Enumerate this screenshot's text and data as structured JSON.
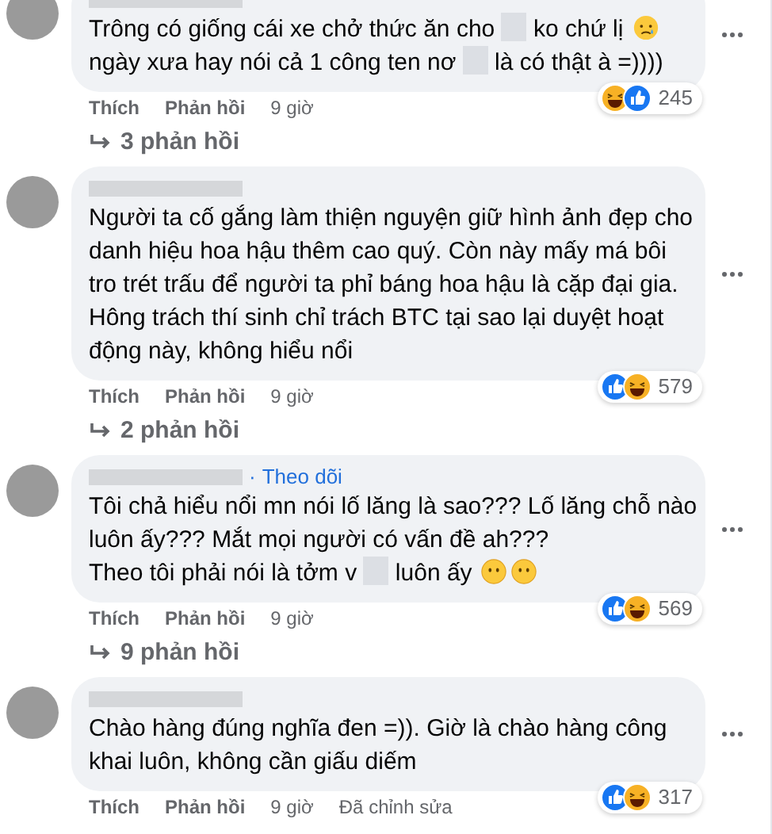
{
  "comments": [
    {
      "lines": [
        [
          {
            "kind": "text",
            "text": "Trông có giống cái xe chở thức ăn cho"
          },
          {
            "kind": "redacted"
          },
          {
            "kind": "text",
            "text": "ko chứ lị"
          },
          {
            "kind": "sad_emoji"
          }
        ],
        [
          {
            "kind": "text",
            "text": "ngày xưa hay nói cả 1 công ten nơ"
          },
          {
            "kind": "redacted"
          },
          {
            "kind": "text",
            "text": "là có thật à =))))"
          }
        ]
      ],
      "reactions": [
        {
          "kind": "haha"
        },
        {
          "kind": "like"
        }
      ],
      "reaction_count": "245",
      "actions": [
        "Thích",
        "Phản hồi"
      ],
      "time": "9 giờ",
      "replies": "3 phản hồi"
    },
    {
      "lines": [
        [
          {
            "kind": "text",
            "text": "Người ta cố gắng làm thiện nguyện giữ hình ảnh đẹp cho"
          }
        ],
        [
          {
            "kind": "text",
            "text": "danh hiệu hoa hậu thêm cao quý. Còn này mấy má bôi"
          }
        ],
        [
          {
            "kind": "text",
            "text": "tro trét trấu để người ta phỉ báng hoa hậu là cặp đại gia."
          }
        ],
        [
          {
            "kind": "text",
            "text": "Hông trách thí sinh chỉ trách BTC tại sao lại duyệt hoạt"
          }
        ],
        [
          {
            "kind": "text",
            "text": "động này, không hiểu nổi"
          }
        ]
      ],
      "reactions": [
        {
          "kind": "like"
        },
        {
          "kind": "haha"
        }
      ],
      "reaction_count": "579",
      "actions": [
        "Thích",
        "Phản hồi"
      ],
      "time": "9 giờ",
      "replies": "2 phản hồi"
    },
    {
      "separator": "·",
      "follow": "Theo dõi",
      "lines": [
        [
          {
            "kind": "text",
            "text": "Tôi chả hiểu nổi mn nói lố lăng là sao??? Lố lăng chỗ nào"
          }
        ],
        [
          {
            "kind": "text",
            "text": "luôn ấy??? Mắt mọi người có vấn đề ah???"
          }
        ],
        [
          {
            "kind": "text",
            "text": "Theo tôi phải nói là tởm v"
          },
          {
            "kind": "redacted"
          },
          {
            "kind": "text",
            "text": "luôn ấy"
          },
          {
            "kind": "blank_emoji"
          },
          {
            "kind": "blank_emoji"
          }
        ]
      ],
      "reactions": [
        {
          "kind": "like"
        },
        {
          "kind": "haha"
        }
      ],
      "reaction_count": "569",
      "actions": [
        "Thích",
        "Phản hồi"
      ],
      "time": "9 giờ",
      "replies": "9 phản hồi"
    },
    {
      "lines": [
        [
          {
            "kind": "text",
            "text": "Chào hàng đúng nghĩa đen =)). Giờ là chào hàng công"
          }
        ],
        [
          {
            "kind": "text",
            "text": "khai luôn, không cần giấu diếm"
          }
        ]
      ],
      "reactions": [
        {
          "kind": "like"
        },
        {
          "kind": "haha"
        }
      ],
      "reaction_count": "317",
      "actions": [
        "Thích",
        "Phản hồi"
      ],
      "time": "9 giờ",
      "edited": "Đã chỉnh sửa"
    }
  ]
}
